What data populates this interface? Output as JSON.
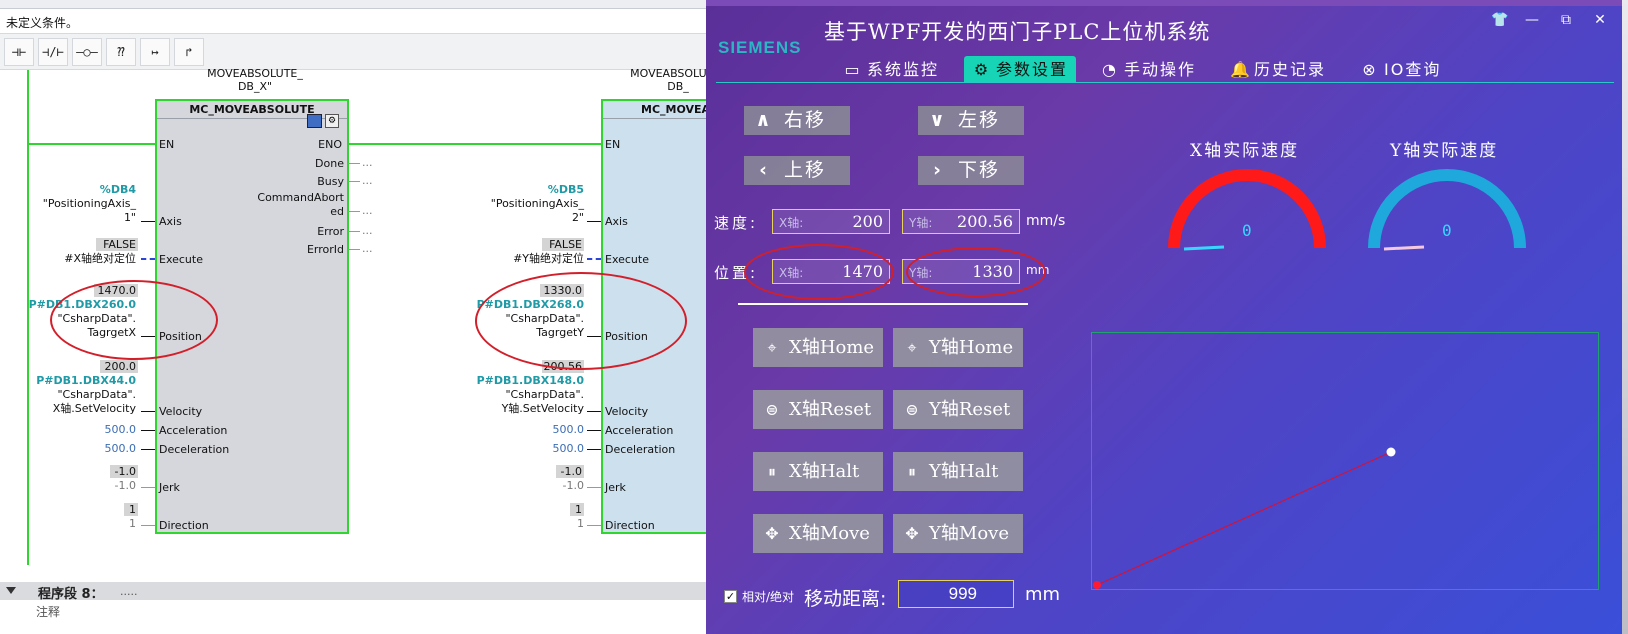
{
  "tia": {
    "condition_text": "未定义条件。",
    "toolbar": [
      "⊣⊢",
      "⊣/⊢",
      "–○–",
      "⁇",
      "↦",
      "↱"
    ],
    "block_x": {
      "instance": [
        "MOVEABSOLUTE_",
        "DB_X\""
      ],
      "title": "MC_MOVEABSOLUTE",
      "en": "EN",
      "eno": "ENO",
      "outputs": [
        "Done",
        "Busy",
        "CommandAbort",
        "ed",
        "Error",
        "ErrorId"
      ],
      "out_dots": "...",
      "inputs": {
        "axis": "Axis",
        "execute": "Execute",
        "position": "Position",
        "velocity": "Velocity",
        "acceleration": "Acceleration",
        "deceleration": "Deceleration",
        "jerk": "Jerk",
        "direction": "Direction"
      },
      "axis_db": "%DB4",
      "axis_name": [
        "\"PositioningAxis_",
        "1\""
      ],
      "exec_val": "FALSE",
      "exec_tag": "#X轴绝对定位",
      "pos_val": "1470.0",
      "pos_addr": "P#DB1.DBX260.0",
      "pos_tag": [
        "\"CsharpData\".",
        "TagrgetX"
      ],
      "vel_val": "200.0",
      "vel_addr": "P#DB1.DBX44.0",
      "vel_tag": [
        "\"CsharpData\".",
        "X轴.SetVelocity"
      ],
      "acc": "500.0",
      "dec": "500.0",
      "jerk_val": "-1.0",
      "jerk_def": "-1.0",
      "dir_val": "1",
      "dir_def": "1"
    },
    "block_y": {
      "instance": [
        "MOVEABSOLUTE_",
        "DB_"
      ],
      "title": "MC_MOVEA",
      "en": "EN",
      "axis_db": "%DB5",
      "axis_name": [
        "\"PositioningAxis_",
        "2\""
      ],
      "exec_val": "FALSE",
      "exec_tag": "#Y轴绝对定位",
      "pos_val": "1330.0",
      "pos_addr": "P#DB1.DBX268.0",
      "pos_tag": [
        "\"CsharpData\".",
        "TagrgetY"
      ],
      "vel_val": "200.56",
      "vel_addr": "P#DB1.DBX148.0",
      "vel_tag": [
        "\"CsharpData\".",
        "Y轴.SetVelocity"
      ],
      "acc": "500.0",
      "dec": "500.0",
      "jerk_val": "-1.0",
      "jerk_def": "-1.0",
      "dir_val": "1",
      "dir_def": "1"
    },
    "segment": "程序段 8：",
    "segment_dots": ".....",
    "comment": "注释"
  },
  "app": {
    "logo": "SIEMENS",
    "title": "基于WPF开发的西门子PLC上位机系统",
    "window_controls": {
      "skin": "👕",
      "minimize": "—",
      "maximize": "⧉",
      "close": "✕"
    },
    "nav": [
      {
        "icon": "▭",
        "label": "系统监控"
      },
      {
        "icon": "⚙",
        "label": "参数设置"
      },
      {
        "icon": "◔",
        "label": "手动操作"
      },
      {
        "icon": "🔔",
        "label": "历史记录"
      },
      {
        "icon": "⊗",
        "label": "IO查询"
      }
    ],
    "dir_buttons": [
      {
        "icon": "∧",
        "label": "右移"
      },
      {
        "icon": "∨",
        "label": "左移"
      },
      {
        "icon": "‹",
        "label": "上移"
      },
      {
        "icon": "›",
        "label": "下移"
      }
    ],
    "speed": {
      "label": "速度:",
      "x_placeholder": "X轴:",
      "x_value": "200",
      "y_placeholder": "Y轴:",
      "y_value": "200.56",
      "unit": "mm/s"
    },
    "position": {
      "label": "位置:",
      "x_placeholder": "X轴:",
      "x_value": "1470",
      "y_placeholder": "Y轴:",
      "y_value": "1330",
      "unit": "mm"
    },
    "actions": [
      {
        "icon": "⌖",
        "label": "X轴Home"
      },
      {
        "icon": "⌖",
        "label": "Y轴Home"
      },
      {
        "icon": "⊜",
        "label": "X轴Reset"
      },
      {
        "icon": "⊜",
        "label": "Y轴Reset"
      },
      {
        "icon": "⏸",
        "label": "X轴Halt"
      },
      {
        "icon": "⏸",
        "label": "Y轴Halt"
      },
      {
        "icon": "✥",
        "label": "X轴Move"
      },
      {
        "icon": "✥",
        "label": "Y轴Move"
      }
    ],
    "gauges": [
      {
        "title": "X轴实际速度",
        "value": "0",
        "color": "#ff1a1a"
      },
      {
        "title": "Y轴实际速度",
        "value": "0",
        "color": "#1fa8dc"
      }
    ],
    "relative_checkbox": {
      "checked": true,
      "label": "相对/绝对"
    },
    "move_distance": {
      "label": "移动距离:",
      "value": "999",
      "unit": "mm"
    },
    "colors": {
      "accent": "#16d4b5",
      "input_border": "#e8d35a",
      "trajectory": "#d3113b",
      "annotation": "#d21f2a"
    }
  }
}
